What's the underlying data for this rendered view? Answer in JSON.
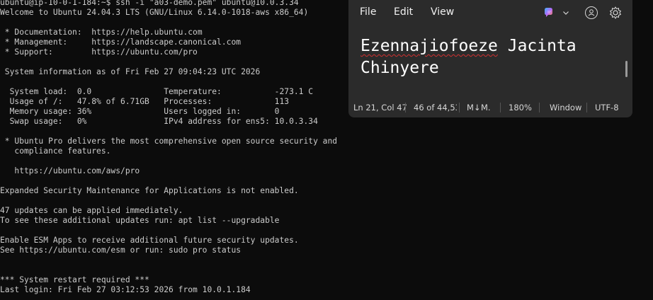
{
  "terminal": {
    "lines": [
      "ubuntu@ip-10-0-1-184:~$ ssh -i \"a03-demo.pem\" ubuntu@10.0.3.34",
      "Welcome to Ubuntu 24.04.3 LTS (GNU/Linux 6.14.0-1018-aws x86_64)",
      "",
      " * Documentation:  https://help.ubuntu.com",
      " * Management:     https://landscape.canonical.com",
      " * Support:        https://ubuntu.com/pro",
      "",
      " System information as of Fri Feb 27 09:04:23 UTC 2026",
      "",
      "  System load:  0.0               Temperature:           -273.1 C",
      "  Usage of /:   47.8% of 6.71GB   Processes:             113",
      "  Memory usage: 36%               Users logged in:       0",
      "  Swap usage:   0%                IPv4 address for ens5: 10.0.3.34",
      "",
      " * Ubuntu Pro delivers the most comprehensive open source security and",
      "   compliance features.",
      "",
      "   https://ubuntu.com/aws/pro",
      "",
      "Expanded Security Maintenance for Applications is not enabled.",
      "",
      "47 updates can be applied immediately.",
      "To see these additional updates run: apt list --upgradable",
      "",
      "Enable ESM Apps to receive additional future security updates.",
      "See https://ubuntu.com/esm or run: sudo pro status",
      "",
      "",
      "*** System restart required ***",
      "Last login: Fri Feb 27 03:12:53 2026 from 10.0.1.184"
    ]
  },
  "notepad": {
    "menu": {
      "file": "File",
      "edit": "Edit",
      "view": "View"
    },
    "content": {
      "first_word": "Ezennajiofoeze",
      "rest_line1": " Jacinta",
      "line2": "Chinyere"
    },
    "status": {
      "position": "Ln 21, Col 47",
      "chars": "46 of 44,53",
      "format_mark": "M↓",
      "format_label": "M.",
      "zoom": "180%",
      "line_ending": "Window",
      "encoding": "UTF-8"
    }
  },
  "icons": {
    "copilot": "copilot-icon",
    "account": "account-icon",
    "settings": "gear-icon",
    "dropdown": "chevron-down-icon"
  },
  "colors": {
    "terminal_bg": "#0c0c0c",
    "terminal_fg": "#cccccc",
    "notepad_bg": "#2b2b2b",
    "spellcheck": "#d03030"
  }
}
